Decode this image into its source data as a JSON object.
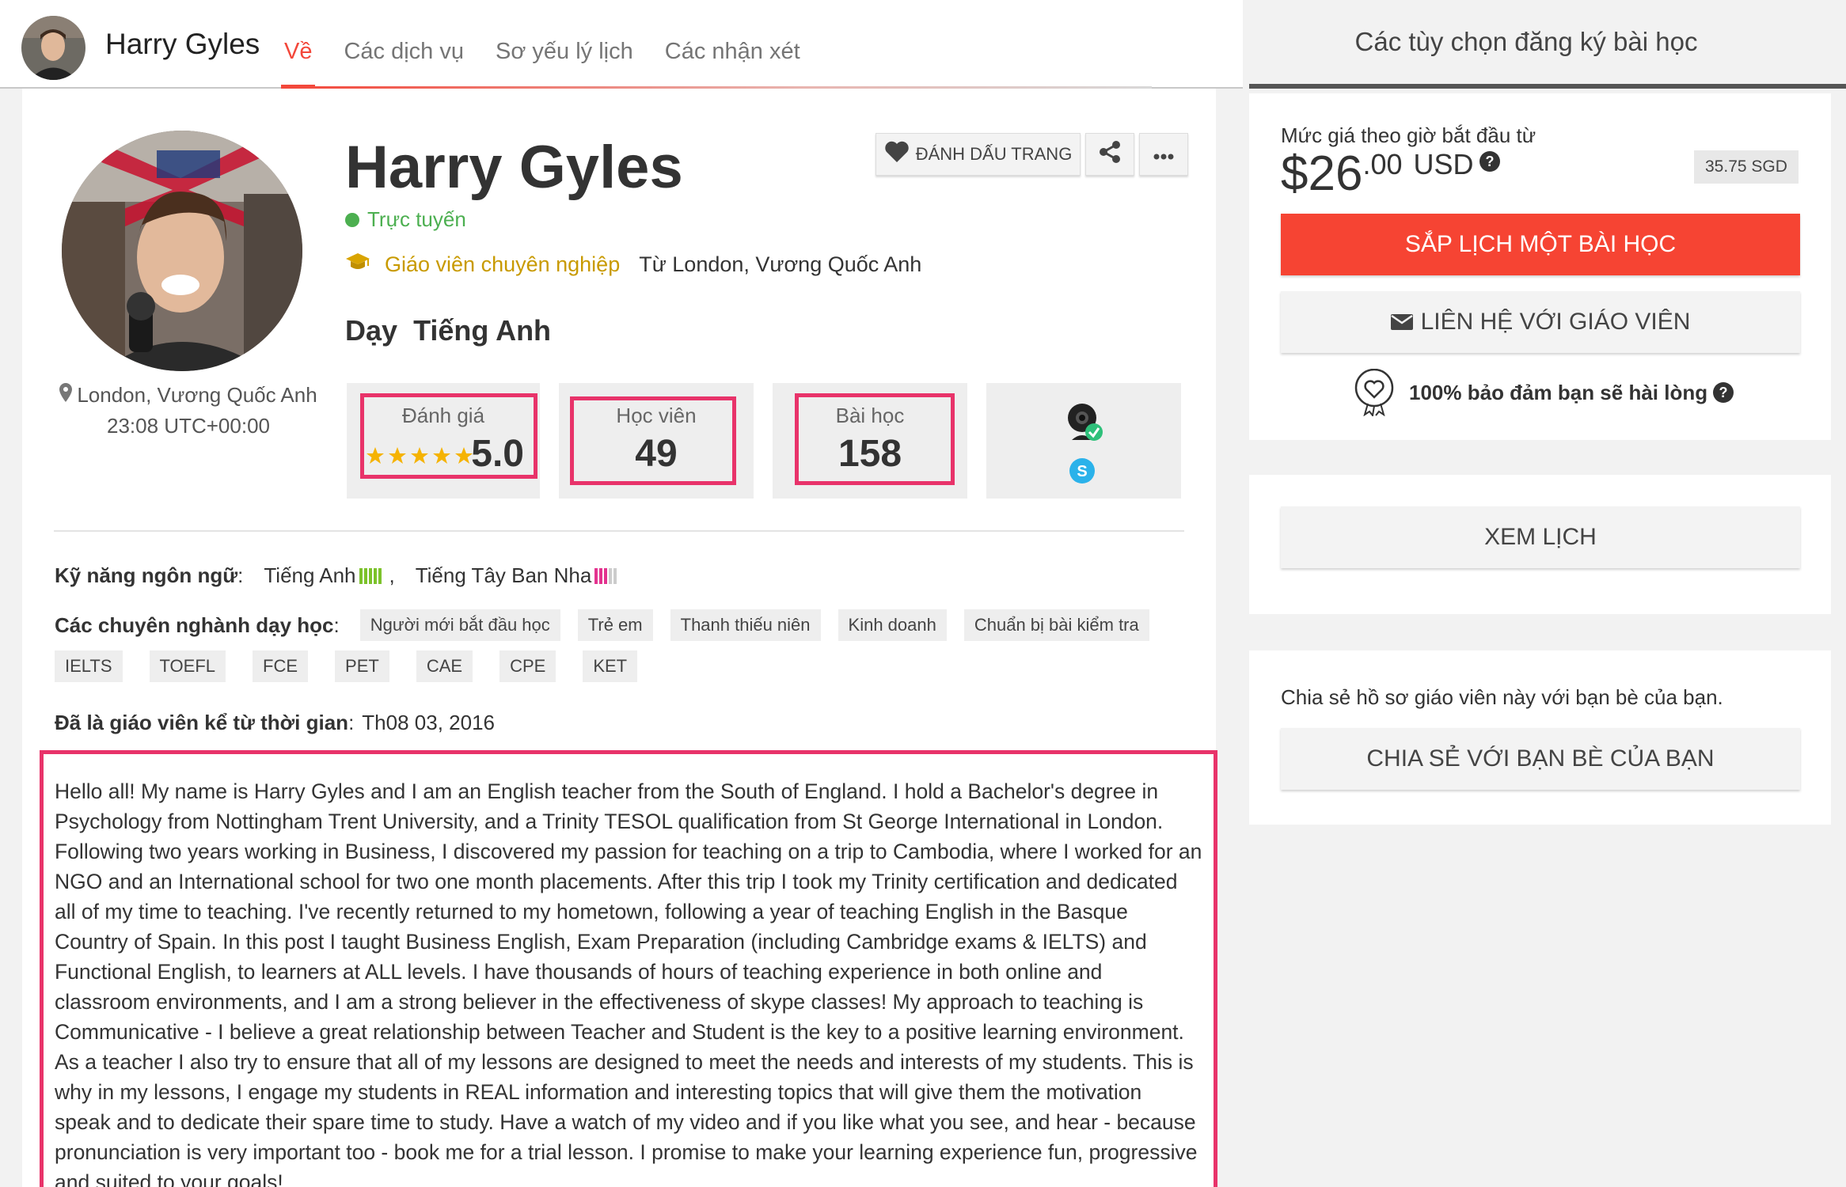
{
  "header": {
    "name": "Harry Gyles",
    "tabs": [
      {
        "label": "Về",
        "active": true
      },
      {
        "label": "Các dịch vụ",
        "active": false
      },
      {
        "label": "Sơ yếu lý lịch",
        "active": false
      },
      {
        "label": "Các nhận xét",
        "active": false
      }
    ]
  },
  "profile": {
    "name": "Harry Gyles",
    "status": "Trực tuyến",
    "teacher_type": "Giáo viên chuyên nghiệp",
    "from": "Từ London, Vương Quốc Anh",
    "teaches_prefix": "Dạy",
    "teaches_language": "Tiếng Anh",
    "location": "London, Vương Quốc Anh",
    "local_time": "23:08 UTC+00:00",
    "bookmark_label": "ĐÁNH DẤU TRANG"
  },
  "stats": {
    "rating_label": "Đánh giá",
    "rating_value": "5.0",
    "rating_stars": 5,
    "students_label": "Học viên",
    "students_value": "49",
    "lessons_label": "Bài học",
    "lessons_value": "158"
  },
  "skills": {
    "label": "Kỹ năng ngôn ngữ",
    "languages": [
      {
        "name": "Tiếng Anh",
        "level": 5,
        "color": "#7cc22b"
      },
      {
        "name": "Tiếng Tây Ban Nha",
        "level": 3,
        "color": "#e3338f"
      }
    ],
    "separator": ","
  },
  "specialties": {
    "label": "Các chuyên nghành dạy học",
    "row1": [
      "Người mới bắt đầu học",
      "Trẻ em",
      "Thanh thiếu niên",
      "Kinh doanh",
      "Chuẩn bị bài kiểm tra"
    ],
    "row2": [
      "IELTS",
      "TOEFL",
      "FCE",
      "PET",
      "CAE",
      "CPE",
      "KET"
    ]
  },
  "teacher_since": {
    "label": "Đã là giáo viên kể từ thời gian",
    "value": "Th08 03, 2016"
  },
  "bio": "Hello all! My name is Harry Gyles and I am an English teacher from the South of England. I hold a Bachelor's degree in Psychology from Nottingham Trent University, and a Trinity TESOL qualification from St George International in London. Following two years working in Business, I discovered my passion for teaching on a trip to Cambodia, where I worked for an NGO and an International school for two one month placements. After this trip I took my Trinity certification and dedicated all of my time to teaching. I've recently returned to my hometown, following a year of teaching English in the Basque Country of Spain. In this post I taught Business English, Exam Preparation (including Cambridge exams & IELTS) and Functional English, to learners at ALL levels. I have thousands of hours of teaching experience in both online and classroom environments, and I am a strong believer in the effectiveness of skype classes! My approach to teaching is Communicative - I believe a great relationship between Teacher and Student is the key to a positive learning environment. As a teacher I also try to ensure that all of my lessons are designed to meet the needs and interests of my students. This is why in my lessons, I engage my students in REAL information and interesting topics that will give them the motivation speak and to dedicate their spare time to study. Have a watch of my video and if you like what you see, and hear - because pronunciation is very important too - book me for a trial lesson. I promise to make your learning experience fun, progressive and suited to your goals!",
  "sidebar": {
    "title": "Các tùy chọn đăng ký bài học",
    "price_label": "Mức giá theo giờ bắt đầu từ",
    "price_dollar": "$26",
    "price_cents": ".00",
    "price_currency": "USD",
    "price_alt": "35.75 SGD",
    "schedule_button": "SẮP LỊCH MỘT BÀI HỌC",
    "contact_button": "LIÊN HỆ VỚI GIÁO VIÊN",
    "guarantee": "100% bảo đảm bạn sẽ hài lòng",
    "calendar_button": "XEM LỊCH",
    "share_text": "Chia sẻ hồ sơ giáo viên này với bạn bè của bạn.",
    "share_button": "CHIA SẺ VỚI BẠN BÈ CỦA BẠN"
  },
  "colors": {
    "accent_red": "#f3473a",
    "highlight_pink": "#e8336a",
    "online_green": "#4caf50",
    "pro_gold": "#c89a00"
  }
}
